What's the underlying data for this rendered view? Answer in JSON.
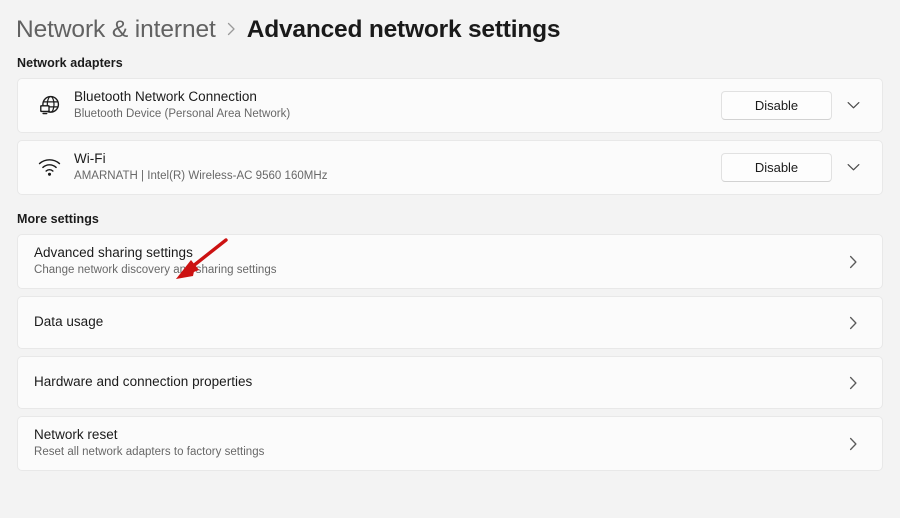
{
  "breadcrumb": {
    "parent": "Network & internet",
    "separator_icon": "chevron-right-icon",
    "current": "Advanced network settings"
  },
  "sections": {
    "adapters_label": "Network adapters",
    "more_label": "More settings"
  },
  "adapters": [
    {
      "icon": "globe-computer-icon",
      "title": "Bluetooth Network Connection",
      "subtitle": "Bluetooth Device (Personal Area Network)",
      "button_label": "Disable",
      "expander_icon": "chevron-down-icon"
    },
    {
      "icon": "wifi-icon",
      "title": "Wi-Fi",
      "subtitle": "AMARNATH | Intel(R) Wireless-AC 9560 160MHz",
      "button_label": "Disable",
      "expander_icon": "chevron-down-icon"
    }
  ],
  "more_settings": [
    {
      "title": "Advanced sharing settings",
      "subtitle": "Change network discovery and sharing settings",
      "chevron_icon": "chevron-right-icon"
    },
    {
      "title": "Data usage",
      "subtitle": "",
      "chevron_icon": "chevron-right-icon"
    },
    {
      "title": "Hardware and connection properties",
      "subtitle": "",
      "chevron_icon": "chevron-right-icon"
    },
    {
      "title": "Network reset",
      "subtitle": "Reset all network adapters to factory settings",
      "chevron_icon": "chevron-right-icon"
    }
  ],
  "annotation": {
    "type": "arrow",
    "color": "#cc1212",
    "points_to": "Advanced sharing settings"
  },
  "colors": {
    "page_background": "#f3f3f3",
    "card_background": "#fbfbfb",
    "card_border": "#e8e8e8",
    "text_primary": "#1b1b1b",
    "text_secondary": "#686868",
    "annotation_red": "#cc1212"
  }
}
